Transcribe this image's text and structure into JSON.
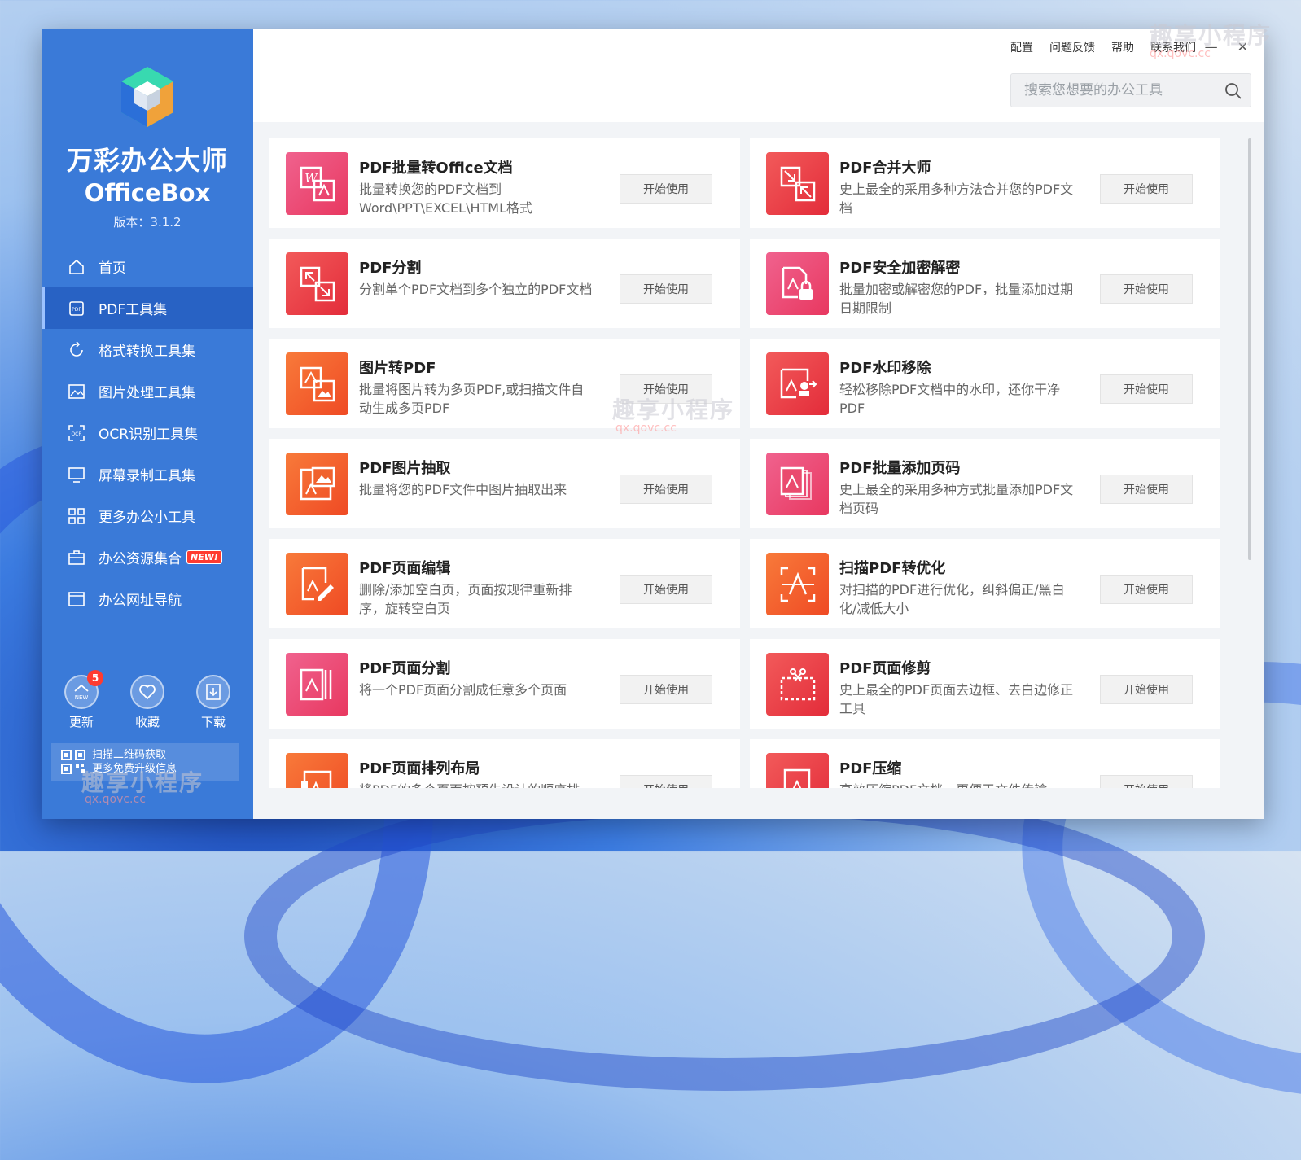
{
  "app": {
    "name_cn": "万彩办公大师",
    "name_en": "OfficeBox",
    "version": "版本：3.1.2"
  },
  "nav": {
    "items": [
      {
        "label": "首页",
        "icon": "home-icon",
        "active": false
      },
      {
        "label": "PDF工具集",
        "icon": "pdf-icon",
        "active": true
      },
      {
        "label": "格式转换工具集",
        "icon": "convert-icon",
        "active": false
      },
      {
        "label": "图片处理工具集",
        "icon": "image-icon",
        "active": false
      },
      {
        "label": "OCR识别工具集",
        "icon": "ocr-icon",
        "active": false
      },
      {
        "label": "屏幕录制工具集",
        "icon": "monitor-icon",
        "active": false
      },
      {
        "label": "更多办公小工具",
        "icon": "grid-icon",
        "active": false
      },
      {
        "label": "办公资源集合",
        "icon": "briefcase-icon",
        "active": false,
        "badge": "NEW!"
      },
      {
        "label": "办公网址导航",
        "icon": "browser-icon",
        "active": false
      }
    ]
  },
  "bottom": {
    "update_label": "更新",
    "update_count": "5",
    "update_icon_text": "NEW",
    "favorite_label": "收藏",
    "download_label": "下载",
    "qr_line1": "扫描二维码获取",
    "qr_line2": "更多免费升级信息"
  },
  "topbar": {
    "links": [
      "配置",
      "问题反馈",
      "帮助",
      "联系我们"
    ],
    "minimize": "—",
    "close": "✕",
    "search_placeholder": "搜索您想要的办公工具"
  },
  "tools": [
    {
      "title": "PDF批量转Office文档",
      "desc": "批量转换您的PDF文档到Word\\PPT\\EXCEL\\HTML格式",
      "button": "开始使用",
      "color": "pink",
      "icon": "word-pdf-icon"
    },
    {
      "title": "PDF合并大师",
      "desc": "史上最全的采用多种方法合并您的PDF文档",
      "button": "开始使用",
      "color": "red",
      "icon": "merge-icon"
    },
    {
      "title": "PDF分割",
      "desc": "分割单个PDF文档到多个独立的PDF文档",
      "button": "开始使用",
      "color": "red",
      "icon": "split-icon"
    },
    {
      "title": "PDF安全加密解密",
      "desc": "批量加密或解密您的PDF，批量添加过期日期限制",
      "button": "开始使用",
      "color": "pink",
      "icon": "lock-icon"
    },
    {
      "title": "图片转PDF",
      "desc": "批量将图片转为多页PDF,或扫描文件自动生成多页PDF",
      "button": "开始使用",
      "color": "orange",
      "icon": "image-to-pdf-icon"
    },
    {
      "title": "PDF水印移除",
      "desc": "轻松移除PDF文档中的水印，还你干净PDF",
      "button": "开始使用",
      "color": "red",
      "icon": "watermark-remove-icon"
    },
    {
      "title": "PDF图片抽取",
      "desc": "批量将您的PDF文件中图片抽取出来",
      "button": "开始使用",
      "color": "orange",
      "icon": "image-extract-icon"
    },
    {
      "title": "PDF批量添加页码",
      "desc": "史上最全的采用多种方式批量添加PDF文档页码",
      "button": "开始使用",
      "color": "pink",
      "icon": "page-number-icon"
    },
    {
      "title": "PDF页面编辑",
      "desc": "删除/添加空白页，页面按规律重新排序，旋转空白页",
      "button": "开始使用",
      "color": "orange",
      "icon": "page-edit-icon"
    },
    {
      "title": "扫描PDF转优化",
      "desc": "对扫描的PDF进行优化，纠斜偏正/黑白化/减低大小",
      "button": "开始使用",
      "color": "orange",
      "icon": "scan-optimize-icon"
    },
    {
      "title": "PDF页面分割",
      "desc": "将一个PDF页面分割成任意多个页面",
      "button": "开始使用",
      "color": "pink",
      "icon": "page-split-icon"
    },
    {
      "title": "PDF页面修剪",
      "desc": "史上最全的PDF页面去边框、去白边修正工具",
      "button": "开始使用",
      "color": "red",
      "icon": "crop-icon"
    },
    {
      "title": "PDF页面排列布局",
      "desc": "将PDF的多个页面按预先设计的顺序排",
      "button": "开始使用",
      "color": "orange",
      "icon": "layout-icon"
    },
    {
      "title": "PDF压缩",
      "desc": "高效压缩PDF文档，更便于文件传输",
      "button": "开始使用",
      "color": "red",
      "icon": "compress-icon"
    }
  ],
  "watermark": {
    "text": "趣享小程序",
    "sub": "qx.qovc.cc"
  }
}
